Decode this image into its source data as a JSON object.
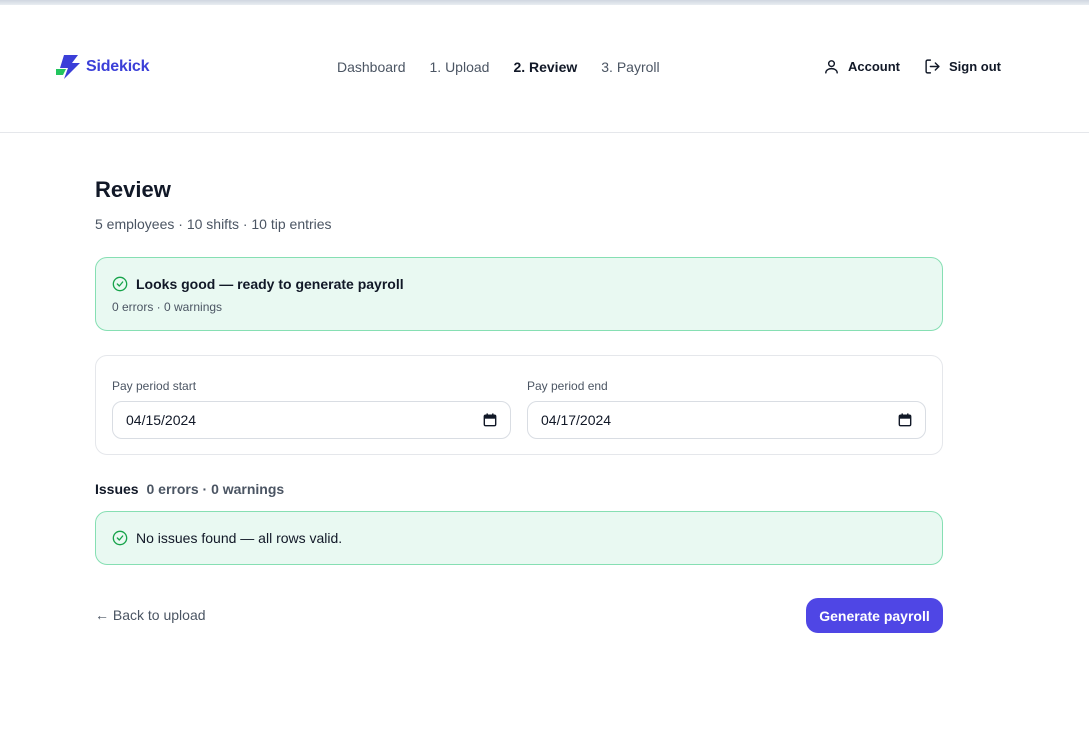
{
  "brand": {
    "name": "Sidekick",
    "color": "#3b3fd8"
  },
  "nav": {
    "items": [
      {
        "label": "Dashboard",
        "active": false
      },
      {
        "label": "1. Upload",
        "active": false
      },
      {
        "label": "2. Review",
        "active": true
      },
      {
        "label": "3. Payroll",
        "active": false
      }
    ]
  },
  "account": {
    "account_label": "Account",
    "account_icon": "user-icon",
    "signout_label": "Sign out",
    "signout_icon": "log-out-icon"
  },
  "page": {
    "title": "Review",
    "subtitle": "5 employees · 10 shifts · 10 tip entries"
  },
  "status_banner": {
    "title": "Looks good — ready to generate payroll",
    "detail": "0 errors · 0 warnings",
    "icon": "check-circle-icon",
    "color": "#16a34a"
  },
  "pay_period": {
    "start_label": "Pay period start",
    "start_value": "04/15/2024",
    "end_label": "Pay period end",
    "end_value": "04/17/2024",
    "icon": "calendar-icon"
  },
  "issues": {
    "label": "Issues",
    "counts": "0 errors · 0 warnings",
    "message": "No issues found — all rows valid."
  },
  "actions": {
    "back_label": "← Back to upload",
    "generate_label": "Generate payroll",
    "accent": "#4f46e5"
  }
}
